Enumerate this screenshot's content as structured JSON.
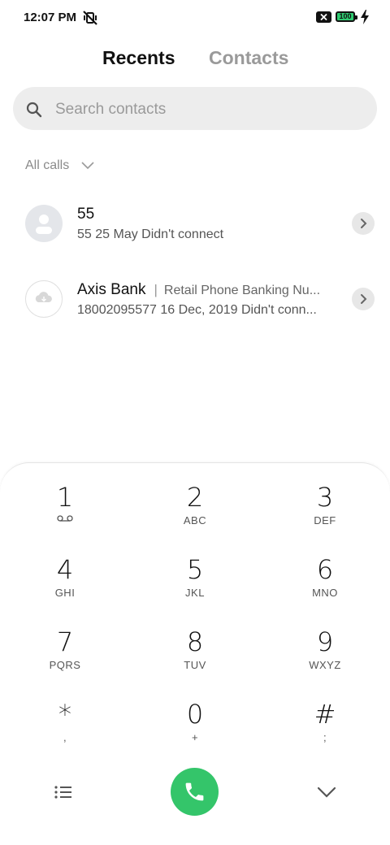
{
  "status_bar": {
    "time": "12:07 PM",
    "battery_level": "100"
  },
  "tabs": [
    {
      "label": "Recents",
      "active": true
    },
    {
      "label": "Contacts",
      "active": false
    }
  ],
  "search": {
    "placeholder": "Search contacts",
    "value": ""
  },
  "filter": {
    "label": "All calls"
  },
  "calls": [
    {
      "name": "55",
      "subtitle": "",
      "number": "55",
      "date": "25 May",
      "status": "Didn't connect"
    },
    {
      "name": "Axis Bank",
      "subtitle": "Retail Phone Banking Nu...",
      "number": "18002095577",
      "date": "16 Dec, 2019",
      "status": "Didn't conn..."
    }
  ],
  "dialpad": {
    "keys": [
      {
        "digit": "1",
        "letters": ""
      },
      {
        "digit": "2",
        "letters": "ABC"
      },
      {
        "digit": "3",
        "letters": "DEF"
      },
      {
        "digit": "4",
        "letters": "GHI"
      },
      {
        "digit": "5",
        "letters": "JKL"
      },
      {
        "digit": "6",
        "letters": "MNO"
      },
      {
        "digit": "7",
        "letters": "PQRS"
      },
      {
        "digit": "8",
        "letters": "TUV"
      },
      {
        "digit": "9",
        "letters": "WXYZ"
      },
      {
        "digit": "*",
        "letters": ","
      },
      {
        "digit": "0",
        "letters": "+"
      },
      {
        "digit": "#",
        "letters": ";"
      }
    ]
  },
  "colors": {
    "call_button": "#34c56a",
    "battery_fill": "#2ecc71",
    "search_bg": "#ededed"
  },
  "icons": [
    "mute-vibrate-icon",
    "battery-x-icon",
    "battery-icon",
    "charging-bolt-icon",
    "search-icon",
    "chevron-down-icon",
    "contact-avatar-icon",
    "cloud-avatar-icon",
    "chevron-right-icon",
    "voicemail-icon",
    "menu-list-icon",
    "phone-icon",
    "collapse-chevron-icon"
  ]
}
